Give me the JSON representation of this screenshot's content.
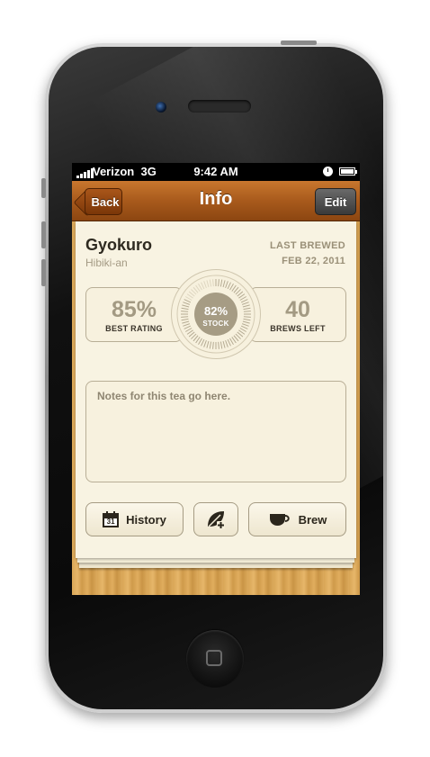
{
  "status_bar": {
    "carrier": "Verizon",
    "network": "3G",
    "time": "9:42 AM"
  },
  "nav": {
    "back_label": "Back",
    "title": "Info",
    "edit_label": "Edit"
  },
  "tea": {
    "name": "Gyokuro",
    "vendor": "Hibiki-an"
  },
  "last_brewed": {
    "label": "LAST BREWED",
    "date": "FEB 22, 2011"
  },
  "stats": {
    "best_rating": {
      "value": "85%",
      "label": "BEST RATING"
    },
    "stock": {
      "value": "82%",
      "label": "STOCK",
      "fraction": 0.82
    },
    "brews_left": {
      "value": "40",
      "label": "BREWS LEFT"
    }
  },
  "notes": {
    "placeholder": "Notes for this tea go here."
  },
  "actions": {
    "history_label": "History",
    "brew_label": "Brew",
    "calendar_day": "31"
  },
  "colors": {
    "nav_brown": "#a85a1c",
    "paper": "#f8f3e2",
    "accent_taupe": "#a69c84"
  }
}
